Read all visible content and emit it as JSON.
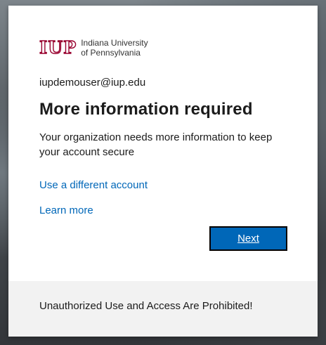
{
  "logo": {
    "mark": "IUP",
    "line1": "Indiana University",
    "line2": "of Pennsylvania"
  },
  "account": {
    "email": "iupdemouser@iup.edu"
  },
  "main": {
    "title": "More information required",
    "description": "Your organization needs more information to keep your account secure",
    "use_different_account": "Use a different account",
    "learn_more": "Learn more",
    "next_label": "Next"
  },
  "footer": {
    "text": "Unauthorized Use and Access Are Prohibited!"
  },
  "colors": {
    "accent": "#0067b8",
    "brand": "#98002e"
  }
}
